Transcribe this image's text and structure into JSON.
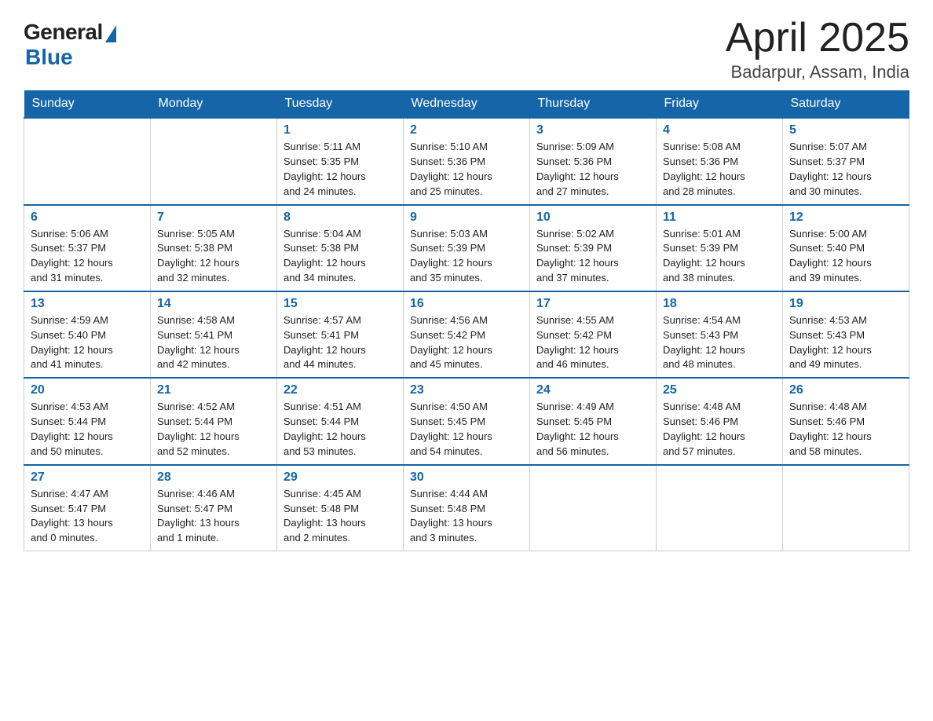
{
  "logo": {
    "general": "General",
    "blue": "Blue"
  },
  "header": {
    "title": "April 2025",
    "subtitle": "Badarpur, Assam, India"
  },
  "weekdays": [
    "Sunday",
    "Monday",
    "Tuesday",
    "Wednesday",
    "Thursday",
    "Friday",
    "Saturday"
  ],
  "weeks": [
    [
      {
        "day": "",
        "info": ""
      },
      {
        "day": "",
        "info": ""
      },
      {
        "day": "1",
        "info": "Sunrise: 5:11 AM\nSunset: 5:35 PM\nDaylight: 12 hours\nand 24 minutes."
      },
      {
        "day": "2",
        "info": "Sunrise: 5:10 AM\nSunset: 5:36 PM\nDaylight: 12 hours\nand 25 minutes."
      },
      {
        "day": "3",
        "info": "Sunrise: 5:09 AM\nSunset: 5:36 PM\nDaylight: 12 hours\nand 27 minutes."
      },
      {
        "day": "4",
        "info": "Sunrise: 5:08 AM\nSunset: 5:36 PM\nDaylight: 12 hours\nand 28 minutes."
      },
      {
        "day": "5",
        "info": "Sunrise: 5:07 AM\nSunset: 5:37 PM\nDaylight: 12 hours\nand 30 minutes."
      }
    ],
    [
      {
        "day": "6",
        "info": "Sunrise: 5:06 AM\nSunset: 5:37 PM\nDaylight: 12 hours\nand 31 minutes."
      },
      {
        "day": "7",
        "info": "Sunrise: 5:05 AM\nSunset: 5:38 PM\nDaylight: 12 hours\nand 32 minutes."
      },
      {
        "day": "8",
        "info": "Sunrise: 5:04 AM\nSunset: 5:38 PM\nDaylight: 12 hours\nand 34 minutes."
      },
      {
        "day": "9",
        "info": "Sunrise: 5:03 AM\nSunset: 5:39 PM\nDaylight: 12 hours\nand 35 minutes."
      },
      {
        "day": "10",
        "info": "Sunrise: 5:02 AM\nSunset: 5:39 PM\nDaylight: 12 hours\nand 37 minutes."
      },
      {
        "day": "11",
        "info": "Sunrise: 5:01 AM\nSunset: 5:39 PM\nDaylight: 12 hours\nand 38 minutes."
      },
      {
        "day": "12",
        "info": "Sunrise: 5:00 AM\nSunset: 5:40 PM\nDaylight: 12 hours\nand 39 minutes."
      }
    ],
    [
      {
        "day": "13",
        "info": "Sunrise: 4:59 AM\nSunset: 5:40 PM\nDaylight: 12 hours\nand 41 minutes."
      },
      {
        "day": "14",
        "info": "Sunrise: 4:58 AM\nSunset: 5:41 PM\nDaylight: 12 hours\nand 42 minutes."
      },
      {
        "day": "15",
        "info": "Sunrise: 4:57 AM\nSunset: 5:41 PM\nDaylight: 12 hours\nand 44 minutes."
      },
      {
        "day": "16",
        "info": "Sunrise: 4:56 AM\nSunset: 5:42 PM\nDaylight: 12 hours\nand 45 minutes."
      },
      {
        "day": "17",
        "info": "Sunrise: 4:55 AM\nSunset: 5:42 PM\nDaylight: 12 hours\nand 46 minutes."
      },
      {
        "day": "18",
        "info": "Sunrise: 4:54 AM\nSunset: 5:43 PM\nDaylight: 12 hours\nand 48 minutes."
      },
      {
        "day": "19",
        "info": "Sunrise: 4:53 AM\nSunset: 5:43 PM\nDaylight: 12 hours\nand 49 minutes."
      }
    ],
    [
      {
        "day": "20",
        "info": "Sunrise: 4:53 AM\nSunset: 5:44 PM\nDaylight: 12 hours\nand 50 minutes."
      },
      {
        "day": "21",
        "info": "Sunrise: 4:52 AM\nSunset: 5:44 PM\nDaylight: 12 hours\nand 52 minutes."
      },
      {
        "day": "22",
        "info": "Sunrise: 4:51 AM\nSunset: 5:44 PM\nDaylight: 12 hours\nand 53 minutes."
      },
      {
        "day": "23",
        "info": "Sunrise: 4:50 AM\nSunset: 5:45 PM\nDaylight: 12 hours\nand 54 minutes."
      },
      {
        "day": "24",
        "info": "Sunrise: 4:49 AM\nSunset: 5:45 PM\nDaylight: 12 hours\nand 56 minutes."
      },
      {
        "day": "25",
        "info": "Sunrise: 4:48 AM\nSunset: 5:46 PM\nDaylight: 12 hours\nand 57 minutes."
      },
      {
        "day": "26",
        "info": "Sunrise: 4:48 AM\nSunset: 5:46 PM\nDaylight: 12 hours\nand 58 minutes."
      }
    ],
    [
      {
        "day": "27",
        "info": "Sunrise: 4:47 AM\nSunset: 5:47 PM\nDaylight: 13 hours\nand 0 minutes."
      },
      {
        "day": "28",
        "info": "Sunrise: 4:46 AM\nSunset: 5:47 PM\nDaylight: 13 hours\nand 1 minute."
      },
      {
        "day": "29",
        "info": "Sunrise: 4:45 AM\nSunset: 5:48 PM\nDaylight: 13 hours\nand 2 minutes."
      },
      {
        "day": "30",
        "info": "Sunrise: 4:44 AM\nSunset: 5:48 PM\nDaylight: 13 hours\nand 3 minutes."
      },
      {
        "day": "",
        "info": ""
      },
      {
        "day": "",
        "info": ""
      },
      {
        "day": "",
        "info": ""
      }
    ]
  ]
}
